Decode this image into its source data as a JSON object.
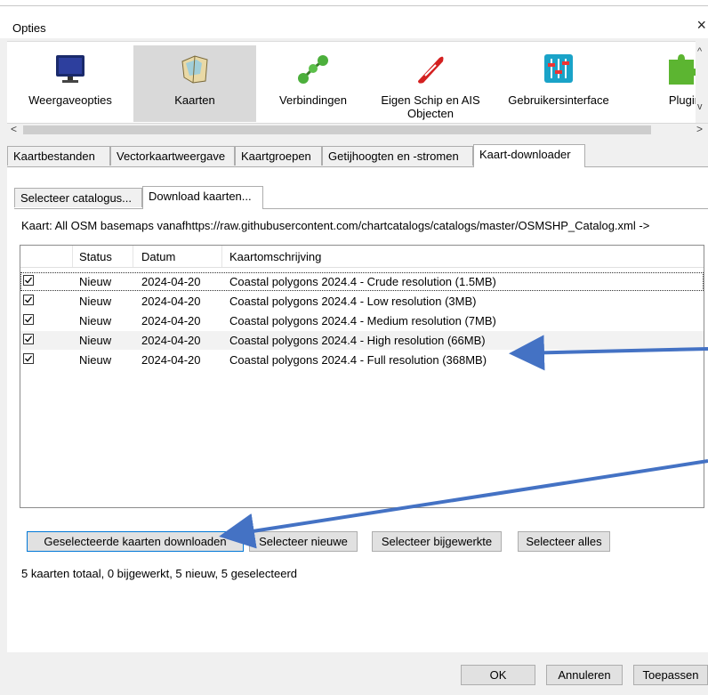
{
  "window": {
    "title": "Opties",
    "close_glyph": "×"
  },
  "toolbar": {
    "items": [
      {
        "label": "Weergaveopties",
        "icon": "monitor-icon",
        "selected": false
      },
      {
        "label": "Kaarten",
        "icon": "chart-map-icon",
        "selected": true
      },
      {
        "label": "Verbindingen",
        "icon": "connections-icon",
        "selected": false
      },
      {
        "label": "Eigen Schip en AIS Objecten",
        "icon": "ship-icon",
        "selected": false
      },
      {
        "label": "Gebruikersinterface",
        "icon": "sliders-icon",
        "selected": false
      },
      {
        "label": "Plugin",
        "icon": "puzzle-icon",
        "selected": false
      }
    ],
    "scroll_left_glyph": "<",
    "scroll_right_glyph": ">",
    "scroll_up_glyph": "^",
    "scroll_down_glyph": "v"
  },
  "tabs_main": [
    {
      "label": "Kaartbestanden",
      "active": false
    },
    {
      "label": "Vectorkaartweergave",
      "active": false
    },
    {
      "label": "Kaartgroepen",
      "active": false
    },
    {
      "label": "Getijhoogten en -stromen",
      "active": false
    },
    {
      "label": "Kaart-downloader",
      "active": true
    }
  ],
  "tabs_sub": [
    {
      "label": "Selecteer catalogus...",
      "active": false
    },
    {
      "label": "Download kaarten...",
      "active": true
    }
  ],
  "kaart_line": "Kaart: All OSM basemaps vanafhttps://raw.githubusercontent.com/chartcatalogs/catalogs/master/OSMSHP_Catalog.xml ->",
  "table": {
    "columns": [
      "Status",
      "Datum",
      "Kaartomschrijving"
    ],
    "rows": [
      {
        "checked": true,
        "status": "Nieuw",
        "date": "2024-04-20",
        "description": "Coastal polygons 2024.4 - Crude resolution (1.5MB)"
      },
      {
        "checked": true,
        "status": "Nieuw",
        "date": "2024-04-20",
        "description": "Coastal polygons 2024.4 - Low resolution (3MB)"
      },
      {
        "checked": true,
        "status": "Nieuw",
        "date": "2024-04-20",
        "description": "Coastal polygons 2024.4 - Medium resolution (7MB)"
      },
      {
        "checked": true,
        "status": "Nieuw",
        "date": "2024-04-20",
        "description": "Coastal polygons 2024.4 - High resolution (66MB)"
      },
      {
        "checked": true,
        "status": "Nieuw",
        "date": "2024-04-20",
        "description": "Coastal polygons 2024.4 - Full resolution (368MB)"
      }
    ]
  },
  "actions": {
    "download": "Geselecteerde kaarten downloaden",
    "select_new": "Selecteer nieuwe",
    "select_updated": "Selecteer bijgewerkte",
    "select_all": "Selecteer alles"
  },
  "status_text": "5 kaarten totaal, 0 bijgewerkt, 5 nieuw, 5 geselecteerd",
  "dialog_buttons": {
    "ok": "OK",
    "cancel": "Annuleren",
    "apply": "Toepassen"
  },
  "annotation_color": "#4472c4"
}
